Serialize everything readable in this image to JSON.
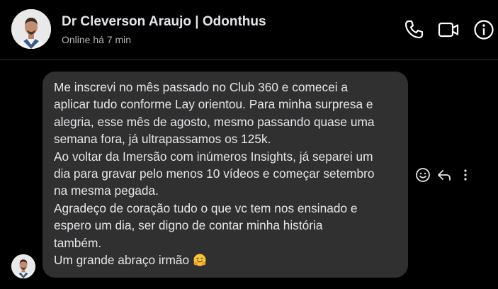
{
  "header": {
    "contact_name": "Dr Cleverson Araujo | Odonthus",
    "status": "Online há 7 min",
    "icons": [
      "phone-icon",
      "video-camera-icon",
      "info-icon"
    ]
  },
  "message": {
    "lines": [
      "Me inscrevi no mês passado no Club 360 e comecei a",
      "aplicar tudo conforme Lay orientou. Para minha surpresa e",
      "alegria, esse mês de agosto, mesmo passando quase uma",
      "semana fora, já ultrapassamos os 125k.",
      "Ao voltar da Imersão com inúmeros Insights, já separei um",
      "dia para gravar pelo menos 10 vídeos e começar setembro",
      "na mesma pegada.",
      "Agradeço de coração tudo o que vc tem nos ensinado e",
      "espero um dia, ser digno de contar minha história",
      "também.",
      "Um grande abraço irmão"
    ],
    "emoji": "hugging-face-icon",
    "actions": [
      "react-smiley-icon",
      "reply-arrow-icon",
      "more-options-icon"
    ]
  },
  "colors": {
    "background": "#000000",
    "bubble": "#303030",
    "text": "#e4e6eb",
    "muted": "#b0b3b8"
  }
}
